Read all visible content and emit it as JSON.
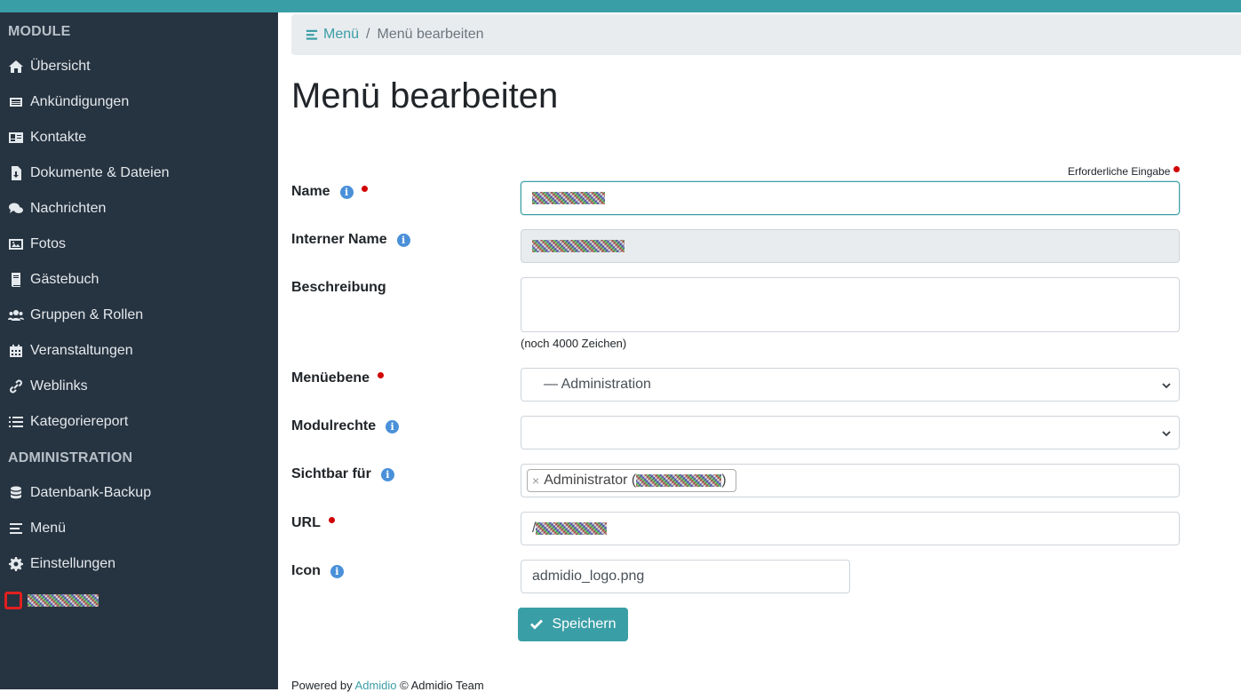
{
  "sidebar": {
    "module_heading": "MODULE",
    "admin_heading": "ADMINISTRATION",
    "module_items": [
      {
        "label": "Übersicht",
        "icon": "home-icon"
      },
      {
        "label": "Ankündigungen",
        "icon": "newspaper-icon"
      },
      {
        "label": "Kontakte",
        "icon": "address-card-icon"
      },
      {
        "label": "Dokumente & Dateien",
        "icon": "file-download-icon"
      },
      {
        "label": "Nachrichten",
        "icon": "comments-icon"
      },
      {
        "label": "Fotos",
        "icon": "image-icon"
      },
      {
        "label": "Gästebuch",
        "icon": "book-icon"
      },
      {
        "label": "Gruppen & Rollen",
        "icon": "users-icon"
      },
      {
        "label": "Veranstaltungen",
        "icon": "calendar-icon"
      },
      {
        "label": "Weblinks",
        "icon": "link-icon"
      },
      {
        "label": "Kategoriereport",
        "icon": "list-icon"
      }
    ],
    "admin_items": [
      {
        "label": "Datenbank-Backup",
        "icon": "database-icon"
      },
      {
        "label": "Menü",
        "icon": "menu-bars-icon"
      },
      {
        "label": "Einstellungen",
        "icon": "gear-icon"
      }
    ]
  },
  "breadcrumb": {
    "link": "Menü",
    "separator": "/",
    "active": "Menü bearbeiten"
  },
  "page_title": "Menü bearbeiten",
  "required_note": "Erforderliche Eingabe",
  "form": {
    "name_label": "Name",
    "internal_name_label": "Interner Name",
    "description_label": "Beschreibung",
    "description_hint": "(noch 4000 Zeichen)",
    "menu_level_label": "Menüebene",
    "menu_level_value": "— Administration",
    "module_rights_label": "Modulrechte",
    "module_rights_value": "",
    "visible_for_label": "Sichtbar für",
    "visible_tag_prefix": "Administrator (",
    "visible_tag_suffix": ")",
    "tag_remove": "×",
    "url_label": "URL",
    "url_prefix": "/",
    "icon_label": "Icon",
    "icon_value": "admidio_logo.png",
    "save_label": "Speichern"
  },
  "footer": {
    "prefix": "Powered by ",
    "link": "Admidio",
    "suffix": " © Admidio Team"
  },
  "colors": {
    "accent": "#3a9ea6",
    "sidebar": "#263340",
    "required": "#d20000",
    "info": "#4a90d9"
  }
}
